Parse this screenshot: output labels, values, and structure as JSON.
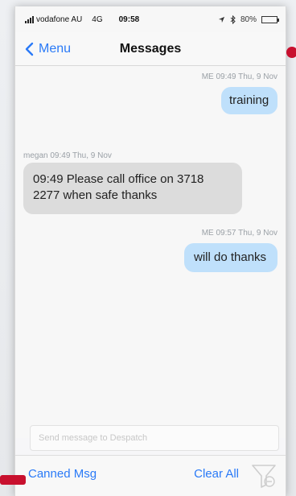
{
  "status_bar": {
    "carrier": "vodafone AU",
    "network": "4G",
    "time": "09:58",
    "battery": "80%",
    "battery_level": 0.8
  },
  "nav": {
    "back_label": "Menu",
    "title": "Messages"
  },
  "messages": [
    {
      "sender": "ME",
      "meta": "ME  09:49 Thu, 9 Nov",
      "text": "training",
      "from_me": true
    },
    {
      "sender": "megan",
      "meta": "megan  09:49 Thu, 9 Nov",
      "text_line1": "09:49 Please call office on 3718",
      "text_line2": "2277 when safe thanks",
      "from_me": false
    },
    {
      "sender": "ME",
      "meta": "ME  09:57 Thu, 9 Nov",
      "text": "will do thanks",
      "from_me": true
    }
  ],
  "compose": {
    "placeholder": "Send message to Despatch",
    "value": ""
  },
  "toolbar": {
    "canned_label": "Canned Msg",
    "clear_label": "Clear All"
  },
  "colors": {
    "accent": "#2a7af7",
    "my_bubble": "#bfe0fb",
    "their_bubble": "#dcdcdc",
    "marker": "#c8102e"
  },
  "icons": {
    "back": "chevron-left-icon",
    "filter": "funnel-filter-icon",
    "bluetooth": "bluetooth-icon",
    "location": "location-arrow-icon"
  }
}
